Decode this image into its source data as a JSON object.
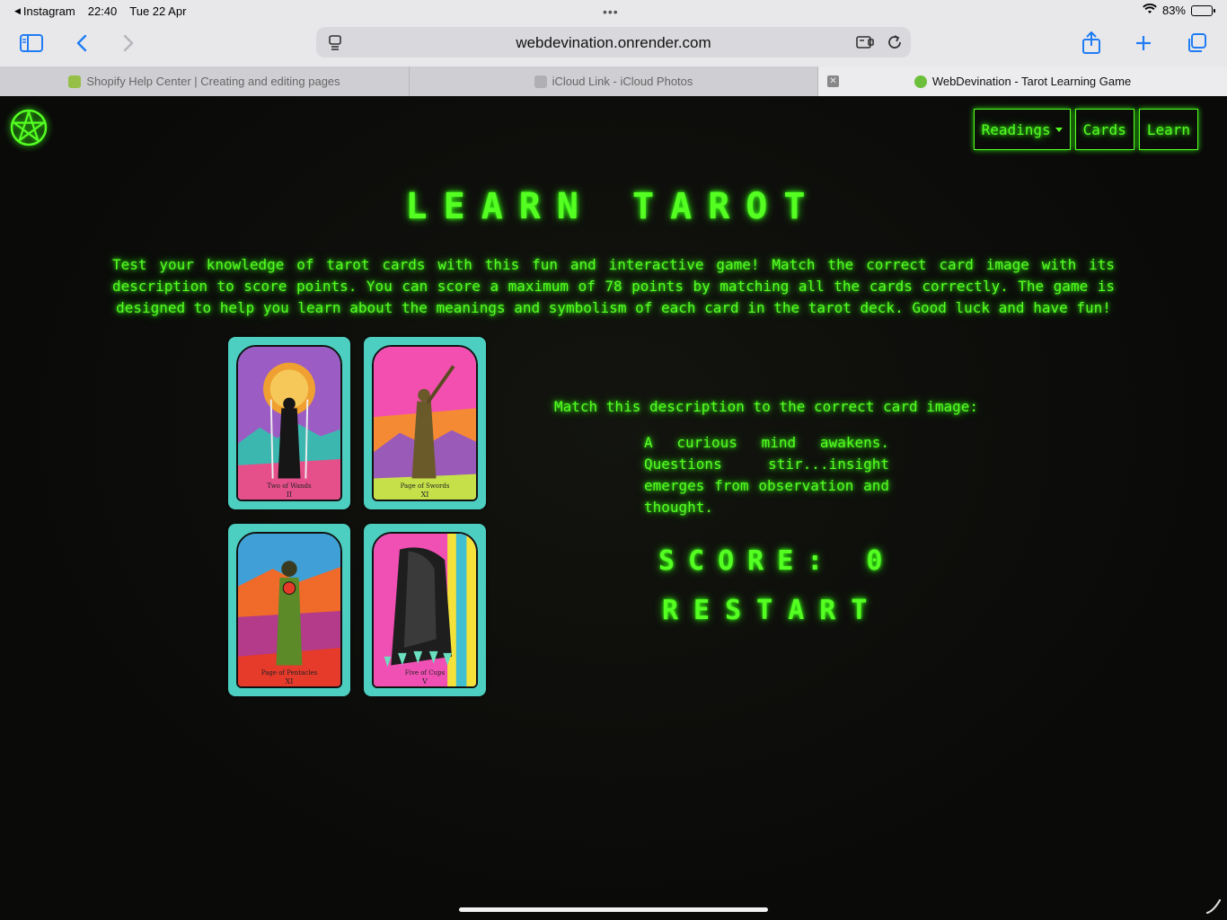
{
  "status_bar": {
    "back_app": "Instagram",
    "time": "22:40",
    "date": "Tue 22 Apr",
    "battery": "83%",
    "battery_level": 0.83
  },
  "browser": {
    "url": "webdevination.onrender.com",
    "tabs": [
      {
        "label": "Shopify Help Center | Creating and editing pages",
        "active": false,
        "favicon_color": "#95bf47"
      },
      {
        "label": "iCloud Link - iCloud Photos",
        "active": false,
        "favicon_color": "#b0b0b4"
      },
      {
        "label": "WebDevination - Tarot Learning Game",
        "active": true,
        "favicon_color": "#6bbf3a"
      }
    ]
  },
  "nav": {
    "readings": "Readings",
    "cards": "Cards",
    "learn": "Learn"
  },
  "page": {
    "title": "LEARN TAROT",
    "intro": "Test your knowledge of tarot cards with this fun and interactive game! Match the correct card image with its description to score points. You can score a maximum of 78 points by matching all the cards correctly. The game is designed to help you learn about the meanings and symbolism of each card in the tarot deck. Good luck and have fun!",
    "prompt": "Match this description to the correct card image:",
    "description": "A curious mind awakens. Questions stir...insight emerges from observation and thought.",
    "score": "SCORE: 0",
    "restart": "RESTART"
  },
  "cards": [
    {
      "name": "Two of Wands",
      "numeral": "II"
    },
    {
      "name": "Page of Swords",
      "numeral": "XI"
    },
    {
      "name": "Page of Pentacles",
      "numeral": "XI"
    },
    {
      "name": "Five of Cups",
      "numeral": "V"
    }
  ],
  "theme": {
    "neon_green": "#55ff22",
    "background": "#0b0b0a",
    "card_frame": "#4ccfc0"
  }
}
